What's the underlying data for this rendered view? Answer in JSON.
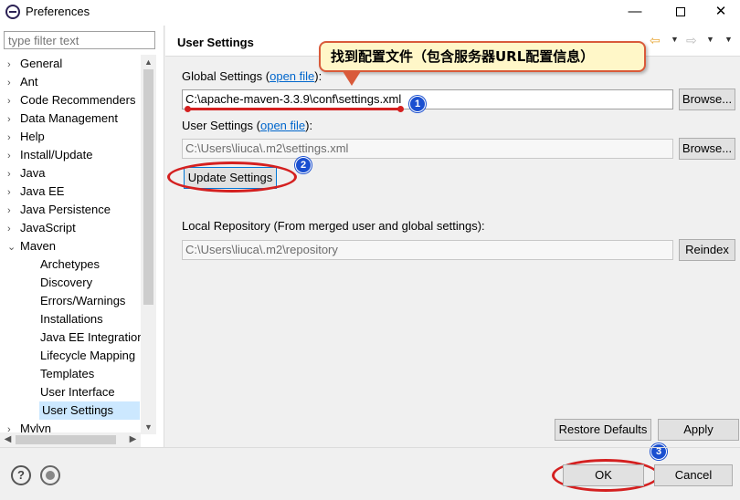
{
  "window": {
    "title": "Preferences",
    "minimize": "—",
    "close": "✕"
  },
  "left": {
    "filter_placeholder": "type filter text",
    "tree": [
      {
        "label": "General",
        "arrow": "›"
      },
      {
        "label": "Ant",
        "arrow": "›"
      },
      {
        "label": "Code Recommenders",
        "arrow": "›"
      },
      {
        "label": "Data Management",
        "arrow": "›"
      },
      {
        "label": "Help",
        "arrow": "›"
      },
      {
        "label": "Install/Update",
        "arrow": "›"
      },
      {
        "label": "Java",
        "arrow": "›"
      },
      {
        "label": "Java EE",
        "arrow": "›"
      },
      {
        "label": "Java Persistence",
        "arrow": "›"
      },
      {
        "label": "JavaScript",
        "arrow": "›"
      },
      {
        "label": "Maven",
        "arrow": "⌄"
      },
      {
        "label": "Archetypes",
        "arrow": ""
      },
      {
        "label": "Discovery",
        "arrow": ""
      },
      {
        "label": "Errors/Warnings",
        "arrow": ""
      },
      {
        "label": "Installations",
        "arrow": ""
      },
      {
        "label": "Java EE Integration",
        "arrow": ""
      },
      {
        "label": "Lifecycle Mapping",
        "arrow": ""
      },
      {
        "label": "Templates",
        "arrow": ""
      },
      {
        "label": "User Interface",
        "arrow": ""
      },
      {
        "label": "User Settings",
        "arrow": ""
      },
      {
        "label": "Mylyn",
        "arrow": "›"
      }
    ]
  },
  "right": {
    "title": "User Settings",
    "global_settings_label": "Global Settings (",
    "global_open_file": "open file",
    "global_settings_suffix": "):",
    "global_settings_value": "C:\\apache-maven-3.3.9\\conf\\settings.xml",
    "browse1": "Browse...",
    "user_settings_label": "User Settings (",
    "user_open_file": "open file",
    "user_settings_suffix": "):",
    "user_settings_value": "C:\\Users\\liuca\\.m2\\settings.xml",
    "browse2": "Browse...",
    "update_settings": "Update Settings",
    "local_repo_label": "Local Repository (From merged user and global settings):",
    "local_repo_value": "C:\\Users\\liuca\\.m2\\repository",
    "reindex": "Reindex",
    "restore_defaults": "Restore Defaults",
    "apply": "Apply"
  },
  "annotation": {
    "callout": "找到配置文件（包含服务器URL配置信息）",
    "badge1": "1",
    "badge2": "2",
    "badge3": "3"
  },
  "footer": {
    "ok": "OK",
    "cancel": "Cancel",
    "help_glyph": "?"
  }
}
